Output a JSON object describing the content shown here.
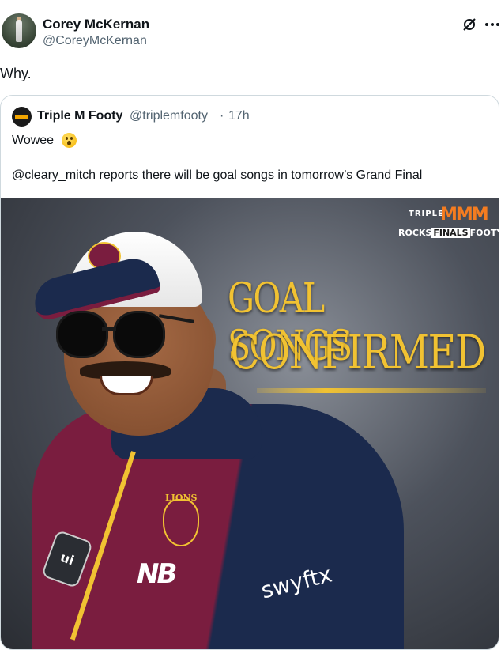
{
  "tweet": {
    "author_name": "Corey McKernan",
    "author_handle": "@CoreyMcKernan",
    "text": "Why."
  },
  "quoted_tweet": {
    "author_name": "Triple M Footy",
    "author_handle": "@triplemfooty",
    "separator": "·",
    "time": "17h",
    "line1": "Wowee",
    "emoji": "astonished-face",
    "line2": "@cleary_mitch reports there will be goal songs in tomorrow’s Grand Final"
  },
  "image": {
    "brand_top": "TRIPLE",
    "brand_m": "MMM",
    "brand_sub_left": "ROCKS",
    "brand_sub_box": "FINALS",
    "brand_sub_right": "FOOTY",
    "headline_1": "GOAL SONGS",
    "headline_2": "CONFIRMED",
    "chest_logo_text": "LIONS",
    "sponsor_text": "swyftx",
    "patch_text": "ui"
  },
  "colors": {
    "accent_gold": "#f1c232",
    "maroon": "#7a1d3f",
    "navy": "#1b2a4d",
    "text_secondary": "#536471"
  }
}
